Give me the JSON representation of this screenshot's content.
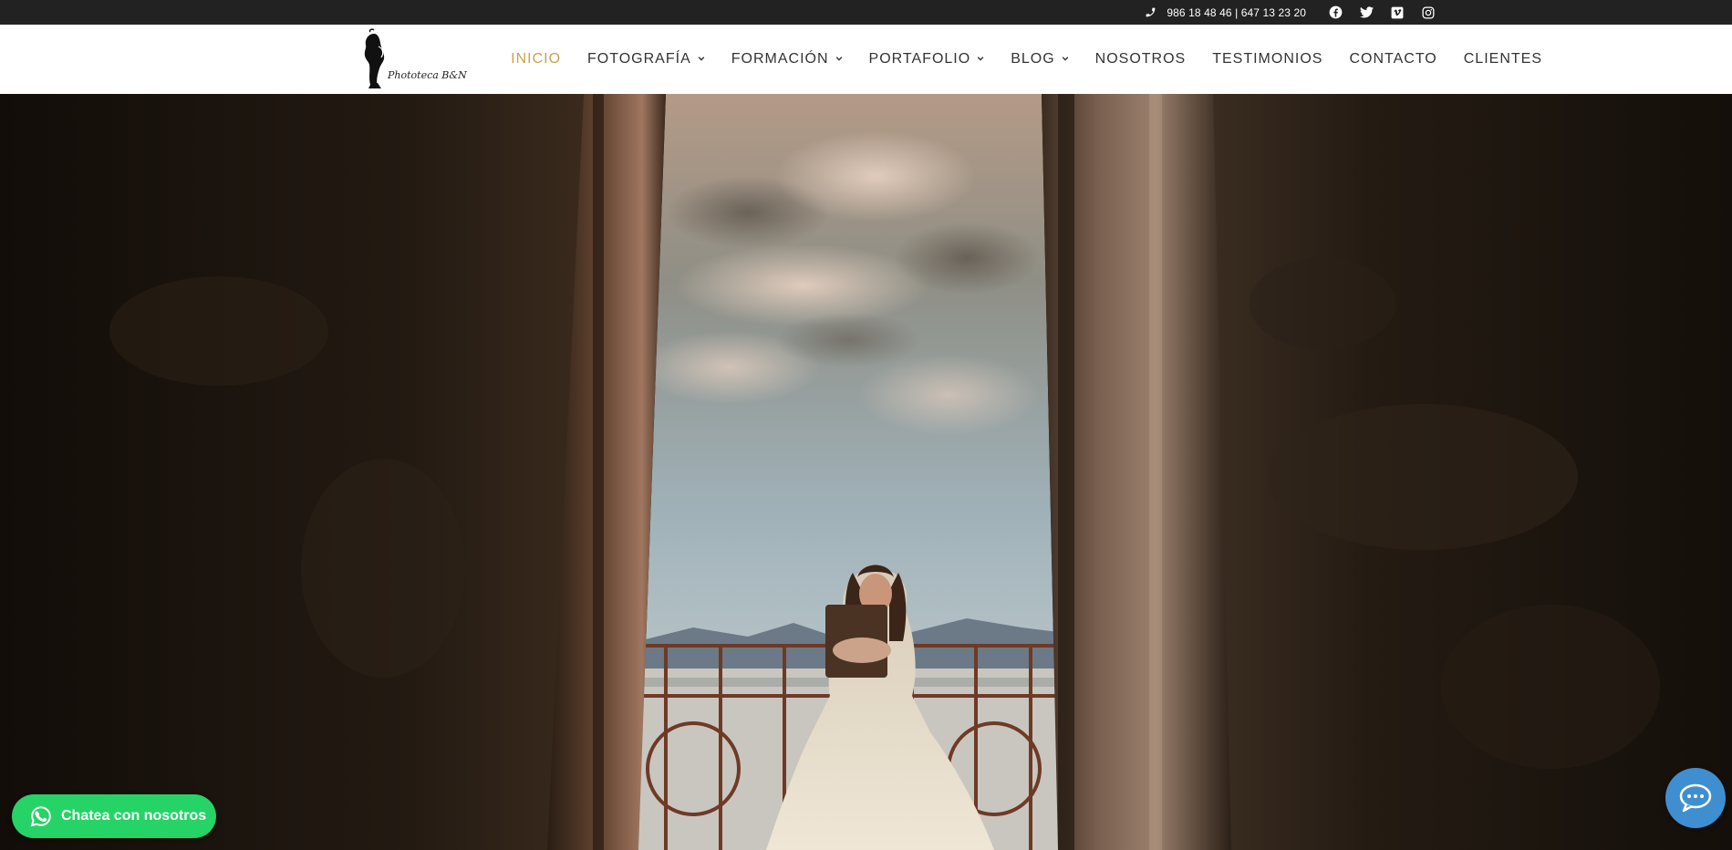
{
  "topbar": {
    "phone": "986 18 48 46 | 647 13 23 20",
    "icons": [
      "phone-icon",
      "facebook-icon",
      "twitter-icon",
      "vimeo-icon",
      "instagram-icon"
    ]
  },
  "header": {
    "logo_text": "Phototeca B&N",
    "nav": [
      {
        "label": "INICIO",
        "active": true,
        "dropdown": false
      },
      {
        "label": "FOTOGRAFÍA",
        "active": false,
        "dropdown": true
      },
      {
        "label": "FORMACIÓN",
        "active": false,
        "dropdown": true
      },
      {
        "label": "PORTAFOLIO",
        "active": false,
        "dropdown": true
      },
      {
        "label": "BLOG",
        "active": false,
        "dropdown": true
      },
      {
        "label": "NOSOTROS",
        "active": false,
        "dropdown": false
      },
      {
        "label": "TESTIMONIOS",
        "active": false,
        "dropdown": false
      },
      {
        "label": "CONTACTO",
        "active": false,
        "dropdown": false
      },
      {
        "label": "CLIENTES",
        "active": false,
        "dropdown": false
      }
    ]
  },
  "whatsapp": {
    "label": "Chatea con nosotros"
  },
  "colors": {
    "accent": "#c9a24a",
    "whatsapp": "#25d366",
    "chat": "#3f8fd0",
    "topbar": "#222222"
  }
}
